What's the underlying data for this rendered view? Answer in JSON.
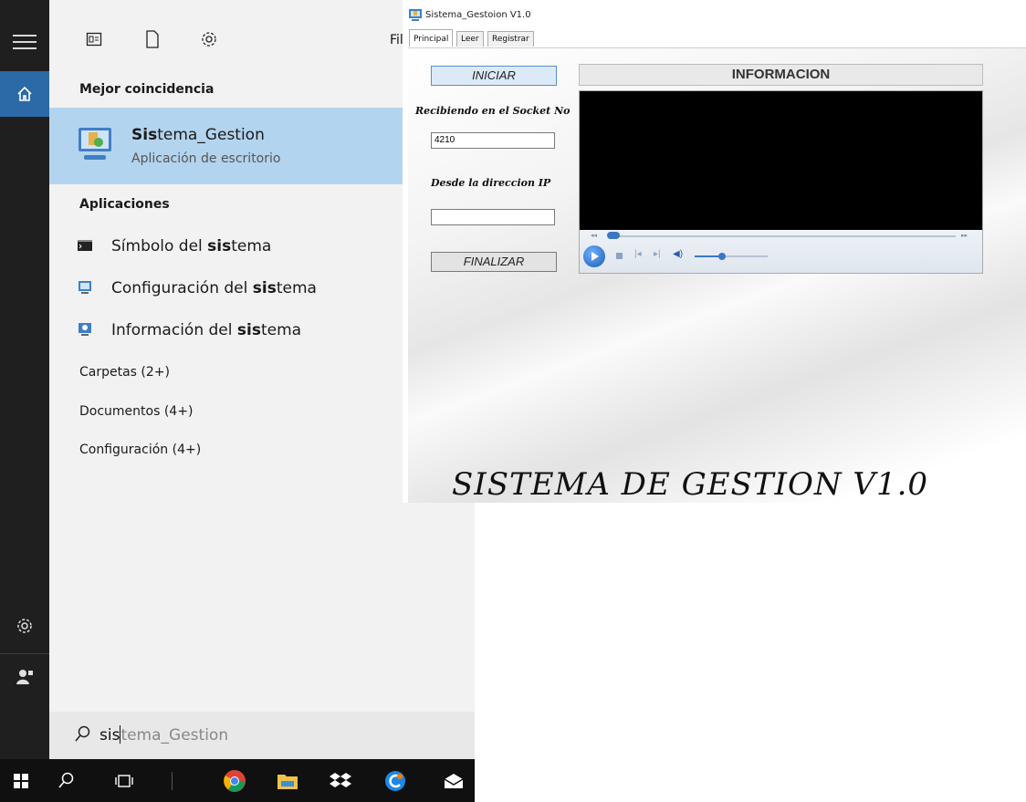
{
  "start_menu": {
    "fragment_text": "Fil",
    "best_match": {
      "header": "Mejor coincidencia",
      "name_bold": "Sis",
      "name_rest": "tema_Gestion",
      "subtitle": "Aplicación de escritorio"
    },
    "apps_header": "Aplicaciones",
    "apps": [
      {
        "pre": "Símbolo del ",
        "bold": "sis",
        "post": "tema"
      },
      {
        "pre": "Configuración del ",
        "bold": "sis",
        "post": "tema"
      },
      {
        "pre": "Información del ",
        "bold": "sis",
        "post": "tema"
      }
    ],
    "groups": [
      "Carpetas (2+)",
      "Documentos (4+)",
      "Configuración (4+)"
    ],
    "search": {
      "typed": "sis",
      "rest": "tema_Gestion"
    }
  },
  "window": {
    "title": "Sistema_Gestoion V1.0",
    "tabs": [
      "Principal",
      "Leer",
      "Registrar"
    ],
    "active_tab": "Principal",
    "iniciar_label": "INICIAR",
    "finalizar_label": "FINALIZAR",
    "socket_label": "Recibiendo en el Socket No",
    "socket_value": "4210",
    "ip_label": "Desde la direccion  IP",
    "ip_value": "",
    "info_label": "INFORMACION",
    "banner": "SISTEMA DE GESTION V1.0"
  },
  "colors": {
    "rail_bg": "#1f1f1f",
    "home_accent": "#2b6aa6",
    "panel_bg": "#f2f2f2",
    "selected_bg": "#b3d4ee",
    "taskbar_bg": "#101010"
  },
  "icons": {
    "rail": [
      "hamburger-icon",
      "home-icon",
      "settings-icon",
      "user-icon"
    ],
    "filters": [
      "apps-filter-icon",
      "documents-filter-icon",
      "settings-filter-icon"
    ],
    "taskbar": [
      "windows-start-icon",
      "search-icon",
      "task-view-icon",
      "chrome-icon",
      "file-explorer-icon",
      "dropbox-icon",
      "ccleaner-icon",
      "mail-icon"
    ],
    "player": [
      "play-icon",
      "stop-icon",
      "previous-icon",
      "next-icon",
      "volume-icon"
    ]
  }
}
